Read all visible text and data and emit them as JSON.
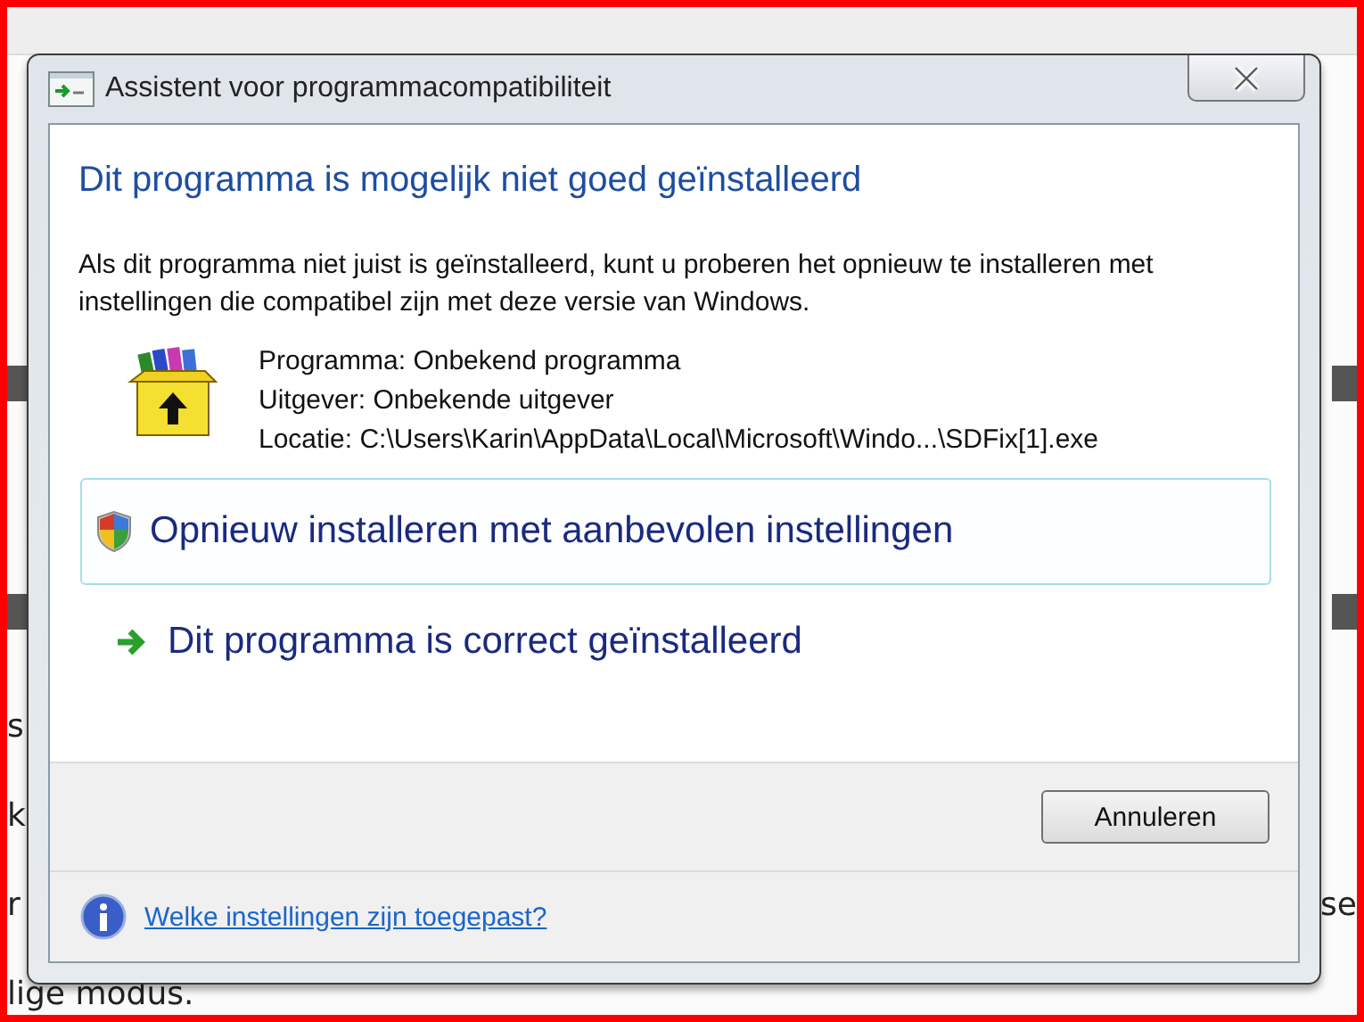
{
  "background_lines": [
    {
      "left": "s"
    },
    {
      "left": "k"
    },
    {
      "left": "r",
      "right": "se"
    },
    {
      "left": "lige modus."
    }
  ],
  "window": {
    "title": "Assistent voor programmacompatibiliteit"
  },
  "heading": "Dit programma is mogelijk niet goed geïnstalleerd",
  "intro": "Als dit programma niet juist is geïnstalleerd, kunt u proberen het opnieuw te installeren met instellingen die compatibel zijn met deze versie van Windows.",
  "program_details": [
    "Programma: Onbekend programma",
    "Uitgever: Onbekende uitgever",
    "Locatie: C:\\Users\\Karin\\AppData\\Local\\Microsoft\\Windo...\\SDFix[1].exe"
  ],
  "options": [
    {
      "kind": "shield",
      "label": "Opnieuw installeren met aanbevolen instellingen",
      "selected": true
    },
    {
      "kind": "arrow",
      "label": "Dit programma is correct geïnstalleerd",
      "selected": false
    }
  ],
  "buttons": [
    "Annuleren"
  ],
  "help_link": "Welke instellingen zijn toegepast?"
}
